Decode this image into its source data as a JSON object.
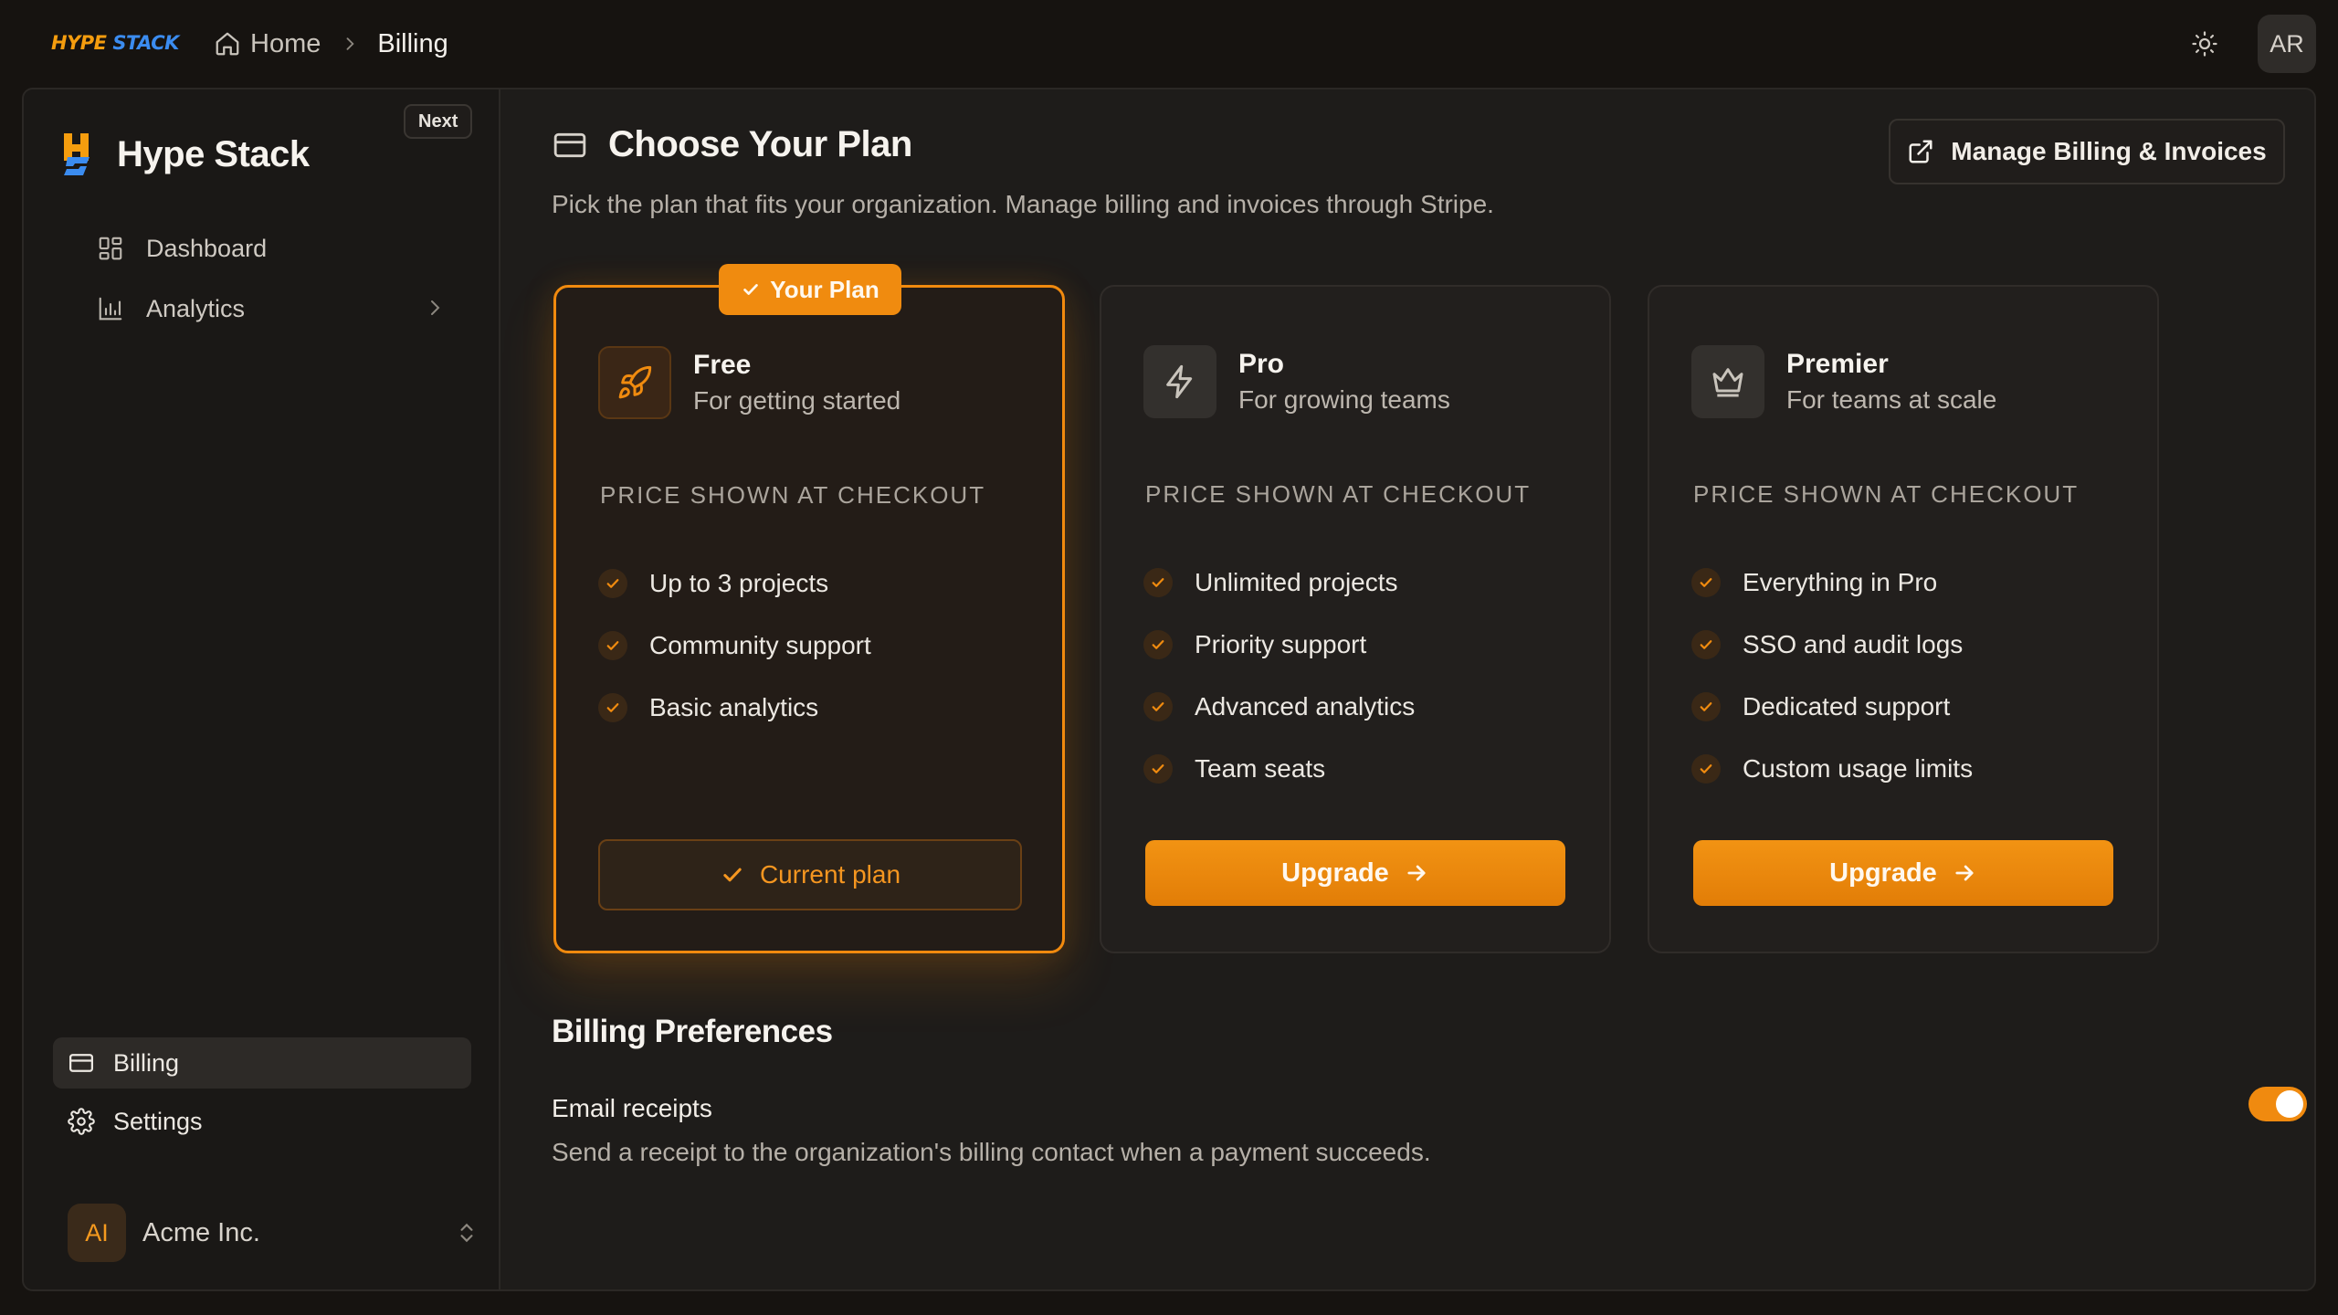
{
  "topbar": {
    "logo_part1": "HYPE",
    "logo_part2": "STACK",
    "breadcrumb": {
      "home": "Home",
      "current": "Billing"
    },
    "user_initials": "AR"
  },
  "sidebar": {
    "brand": "Hype Stack",
    "badge": "Next",
    "nav": [
      {
        "label": "Dashboard",
        "icon": "dashboard-icon"
      },
      {
        "label": "Analytics",
        "icon": "bar-chart-icon"
      }
    ],
    "bottom_nav": [
      {
        "label": "Billing",
        "icon": "credit-card-icon",
        "active": true
      },
      {
        "label": "Settings",
        "icon": "gear-icon"
      }
    ],
    "org": {
      "initials": "AI",
      "name": "Acme Inc."
    }
  },
  "main": {
    "title": "Choose Your Plan",
    "description": "Pick the plan that fits your organization. Manage billing and invoices through Stripe.",
    "manage_button": "Manage Billing & Invoices",
    "plans": [
      {
        "name": "Free",
        "tagline": "For getting started",
        "price_note": "PRICE SHOWN AT CHECKOUT",
        "features": [
          "Up to 3 projects",
          "Community support",
          "Basic analytics"
        ],
        "current": true,
        "badge": "Your Plan",
        "button": "Current plan",
        "icon": "rocket-icon"
      },
      {
        "name": "Pro",
        "tagline": "For growing teams",
        "price_note": "PRICE SHOWN AT CHECKOUT",
        "features": [
          "Unlimited projects",
          "Priority support",
          "Advanced analytics",
          "Team seats"
        ],
        "current": false,
        "button": "Upgrade",
        "icon": "lightning-icon"
      },
      {
        "name": "Premier",
        "tagline": "For teams at scale",
        "price_note": "PRICE SHOWN AT CHECKOUT",
        "features": [
          "Everything in Pro",
          "SSO and audit logs",
          "Dedicated support",
          "Custom usage limits"
        ],
        "current": false,
        "button": "Upgrade",
        "icon": "crown-icon"
      }
    ],
    "preferences": {
      "title": "Billing Preferences",
      "email_receipts": {
        "label": "Email receipts",
        "description": "Send a receipt to the organization's billing contact when a payment succeeds.",
        "enabled": true
      }
    }
  },
  "colors": {
    "accent": "#f08b0f",
    "background": "#161310",
    "panel": "#1e1c1a"
  }
}
